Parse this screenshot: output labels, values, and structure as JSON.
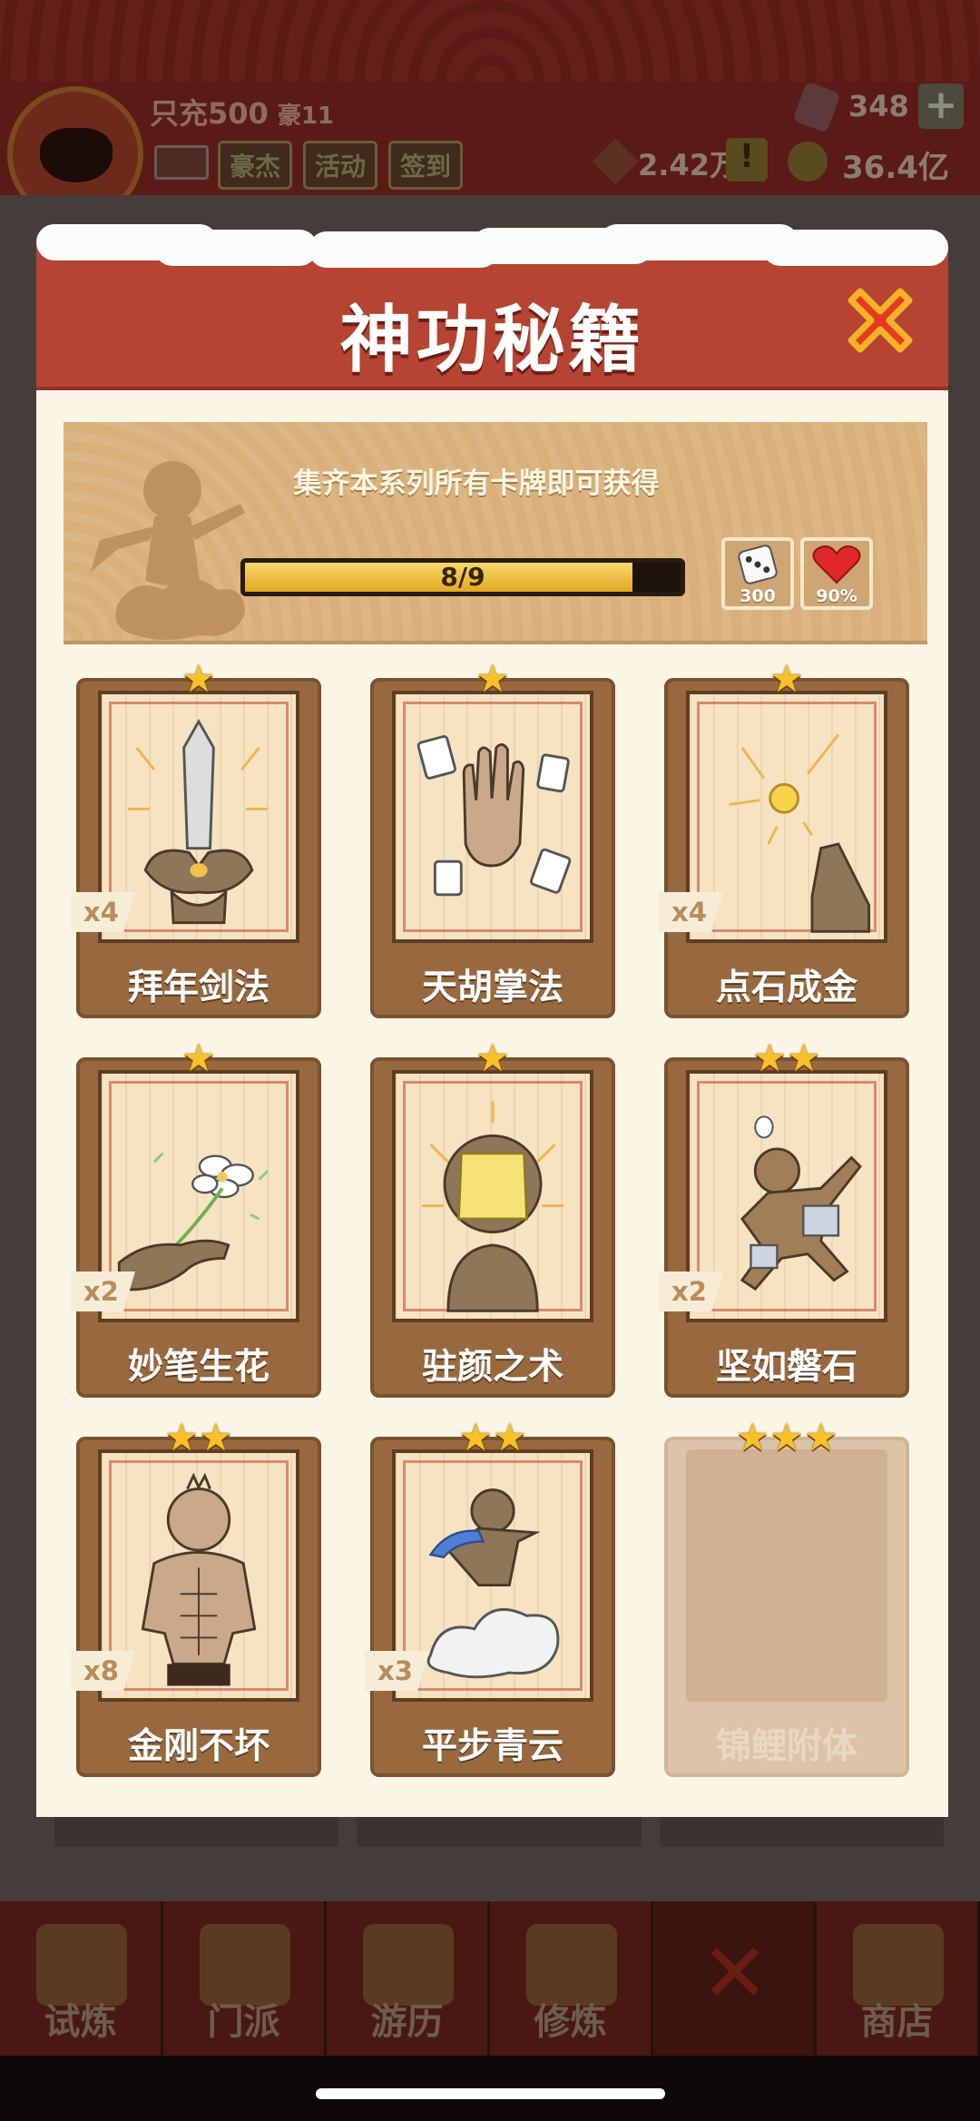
{
  "hud": {
    "player_name": "只充500",
    "vip_level": "豪11",
    "tags": [
      "豪杰",
      "活动",
      "签到"
    ],
    "gems": "348",
    "plus": "+",
    "ingots": "2.42万",
    "alert": "!",
    "coins": "36.4亿"
  },
  "modal": {
    "title": "神功秘籍",
    "close_icon": "close-x-icon",
    "banner": {
      "text": "集齐本系列所有卡牌即可获得",
      "progress_label": "8/9",
      "progress_value": 0.889,
      "rewards": [
        {
          "icon": "dice-icon",
          "value": "300"
        },
        {
          "icon": "heart-icon",
          "value": "90%"
        }
      ]
    },
    "cards": [
      {
        "name": "拜年剑法",
        "stars": "★",
        "count": "x4",
        "art": "sword-icon"
      },
      {
        "name": "天胡掌法",
        "stars": "★",
        "count": "",
        "art": "palm-mahjong-icon"
      },
      {
        "name": "点石成金",
        "stars": "★",
        "count": "x4",
        "art": "midas-finger-icon"
      },
      {
        "name": "妙笔生花",
        "stars": "★",
        "count": "x2",
        "art": "flower-hand-icon"
      },
      {
        "name": "驻颜之术",
        "stars": "★",
        "count": "",
        "art": "face-mask-icon"
      },
      {
        "name": "坚如磐石",
        "stars": "★★",
        "count": "x2",
        "art": "stone-body-icon"
      },
      {
        "name": "金刚不坏",
        "stars": "★★",
        "count": "x8",
        "art": "strongman-icon"
      },
      {
        "name": "平步青云",
        "stars": "★★",
        "count": "x3",
        "art": "cloud-rider-icon"
      },
      {
        "name": "锦鲤附体",
        "stars": "★★★",
        "count": "",
        "art": "locked-card",
        "locked": true
      }
    ]
  },
  "bottom_nav": [
    {
      "label": "试炼",
      "icon": "trial-icon"
    },
    {
      "label": "门派",
      "icon": "sect-icon"
    },
    {
      "label": "游历",
      "icon": "travel-icon"
    },
    {
      "label": "修炼",
      "icon": "cultivate-icon"
    },
    {
      "label": "",
      "icon": "close-x-icon"
    },
    {
      "label": "商店",
      "icon": "shop-icon"
    }
  ],
  "colors": {
    "header_red": "#b54432",
    "card_brown": "#98693f",
    "star_gold": "#f8c02b",
    "progress_gold": "#e2a923"
  }
}
